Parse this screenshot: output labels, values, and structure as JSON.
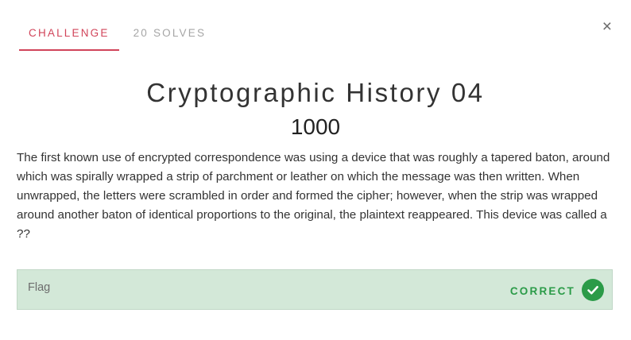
{
  "tabs": {
    "challenge": "CHALLENGE",
    "solves": "20 SOLVES"
  },
  "close_label": "×",
  "challenge": {
    "title": "Cryptographic History 04",
    "points": "1000",
    "description": "The first known use of encrypted correspondence was using a device that was roughly a tapered baton, around which was spirally wrapped a strip of parchment or leather on which the message was then written. When unwrapped, the letters were scrambled in order and formed the cipher; however, when the strip was wrapped around another baton of identical proportions to the original, the plaintext reappeared. This device was called a ??"
  },
  "flag": {
    "placeholder": "Flag",
    "value": "",
    "status": "CORRECT",
    "status_icon": "check-circle-icon"
  },
  "colors": {
    "accent": "#d1445a",
    "success": "#2b9b48",
    "success_bg": "#d3e8d8"
  }
}
